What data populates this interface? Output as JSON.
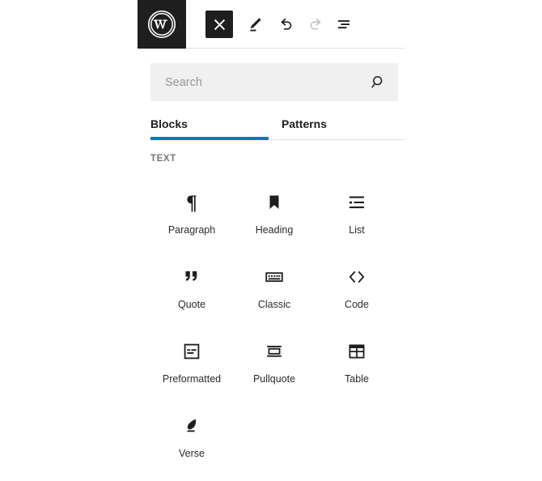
{
  "toolbar": {
    "logo_name": "wordpress-logo",
    "buttons": [
      {
        "name": "close-inserter-button",
        "icon": "close-icon",
        "label": "Close block inserter",
        "state": "active"
      },
      {
        "name": "edit-button",
        "icon": "pencil-icon",
        "label": "Edit",
        "state": "enabled"
      },
      {
        "name": "undo-button",
        "icon": "undo-arrow-icon",
        "label": "Undo",
        "state": "enabled"
      },
      {
        "name": "redo-button",
        "icon": "redo-arrow-icon",
        "label": "Redo",
        "state": "disabled"
      },
      {
        "name": "list-view-button",
        "icon": "list-view-icon",
        "label": "List view",
        "state": "enabled"
      }
    ]
  },
  "search": {
    "placeholder": "Search",
    "value": "",
    "icon": "search-icon"
  },
  "tabs": {
    "active": "Blocks",
    "items": [
      {
        "label": "Blocks"
      },
      {
        "label": "Patterns"
      }
    ]
  },
  "category": {
    "label": "TEXT"
  },
  "blocks": [
    {
      "label": "Paragraph",
      "icon": "paragraph-icon"
    },
    {
      "label": "Heading",
      "icon": "heading-bookmark-icon"
    },
    {
      "label": "List",
      "icon": "list-icon"
    },
    {
      "label": "Quote",
      "icon": "quote-icon"
    },
    {
      "label": "Classic",
      "icon": "keyboard-icon"
    },
    {
      "label": "Code",
      "icon": "code-brackets-icon"
    },
    {
      "label": "Preformatted",
      "icon": "preformatted-icon"
    },
    {
      "label": "Pullquote",
      "icon": "pullquote-icon"
    },
    {
      "label": "Table",
      "icon": "table-grid-icon"
    },
    {
      "label": "Verse",
      "icon": "verse-leaf-icon"
    }
  ],
  "colors": {
    "accent": "#007cba",
    "toolbar_dark": "#1e1e1e",
    "search_background": "#f0f0f0",
    "category_text": "#757575",
    "disabled_icon": "#b8b8b8"
  }
}
